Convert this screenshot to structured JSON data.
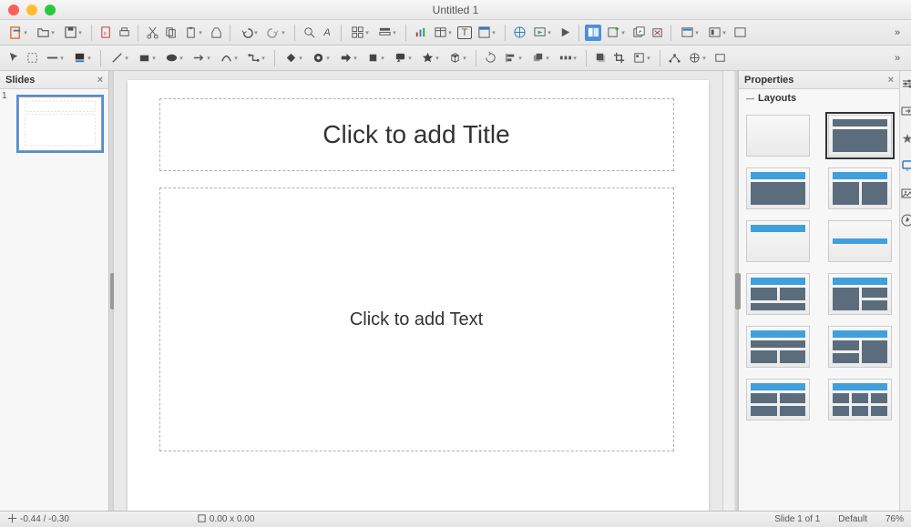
{
  "window": {
    "title": "Untitled 1"
  },
  "panels": {
    "slides": {
      "title": "Slides"
    },
    "properties": {
      "title": "Properties",
      "section_layouts": "Layouts"
    }
  },
  "slides": [
    {
      "number": "1"
    }
  ],
  "placeholders": {
    "title": "Click to add Title",
    "content": "Click to add Text"
  },
  "statusbar": {
    "coords": "-0.44 / -0.30",
    "size": "0.00 x 0.00",
    "slide_of": "Slide 1 of 1",
    "master": "Default",
    "zoom": "76%"
  },
  "layouts": [
    {
      "id": "blank",
      "selected": false
    },
    {
      "id": "title-content",
      "selected": true
    },
    {
      "id": "content-only",
      "selected": false
    },
    {
      "id": "two-content-hdr",
      "selected": false
    },
    {
      "id": "title-only",
      "selected": false
    },
    {
      "id": "centered",
      "selected": false
    },
    {
      "id": "two-over-one",
      "selected": false
    },
    {
      "id": "one-over-two",
      "selected": false
    },
    {
      "id": "hdr-two-over-one",
      "selected": false
    },
    {
      "id": "hdr-one-over-two",
      "selected": false
    },
    {
      "id": "hdr-four",
      "selected": false
    },
    {
      "id": "hdr-six",
      "selected": false
    }
  ]
}
